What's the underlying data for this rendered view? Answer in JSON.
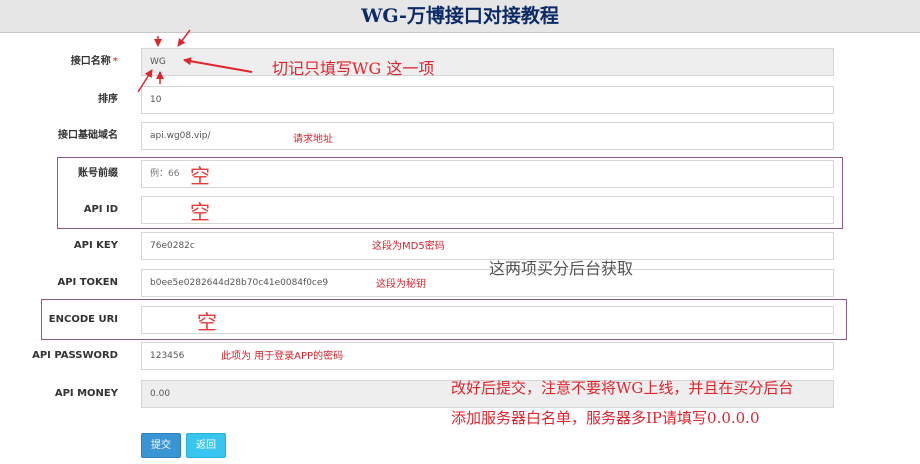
{
  "page": {
    "title": "WG-万博接口对接教程"
  },
  "form": {
    "rows": [
      {
        "label": "接口名称",
        "required_mark": "*",
        "value": "WG",
        "disabled": true
      },
      {
        "label": "排序",
        "value": "10"
      },
      {
        "label": "接口基础域名",
        "value": "api.wg08.vip/"
      },
      {
        "label": "账号前缀",
        "value": "例：66"
      },
      {
        "label": "API ID",
        "value": ""
      },
      {
        "label": "API KEY",
        "value": "76e0282c"
      },
      {
        "label": "API TOKEN",
        "value": "b0ee5e0282644d28b70c41e0084f0ce9"
      },
      {
        "label": "ENCODE URI",
        "value": ""
      },
      {
        "label": "API PASSWORD",
        "value": "123456"
      },
      {
        "label": "API MONEY",
        "value": "0.00",
        "disabled": true
      }
    ]
  },
  "notes": {
    "request_url": "请求地址",
    "md5_key": "这段为MD5密码",
    "secret_key": "这段为秘钥",
    "app_password": "此项为 用于登录APP的密码",
    "empty": "空"
  },
  "callouts": {
    "only_wg": "切记只填写WG 这一项",
    "from_backend": "这两项买分后台获取",
    "submit_line1": "改好后提交，注意不要将WG上线，并且在买分后台",
    "submit_line2": "添加服务器白名单，服务器多IP请填写0.0.0.0"
  },
  "buttons": {
    "submit": "提交",
    "back": "返回"
  },
  "colors": {
    "title_text": "#0b2a66",
    "annotation_red": "#e0242e",
    "submit_button": "#3a95d4",
    "back_button": "#38c6ee"
  }
}
